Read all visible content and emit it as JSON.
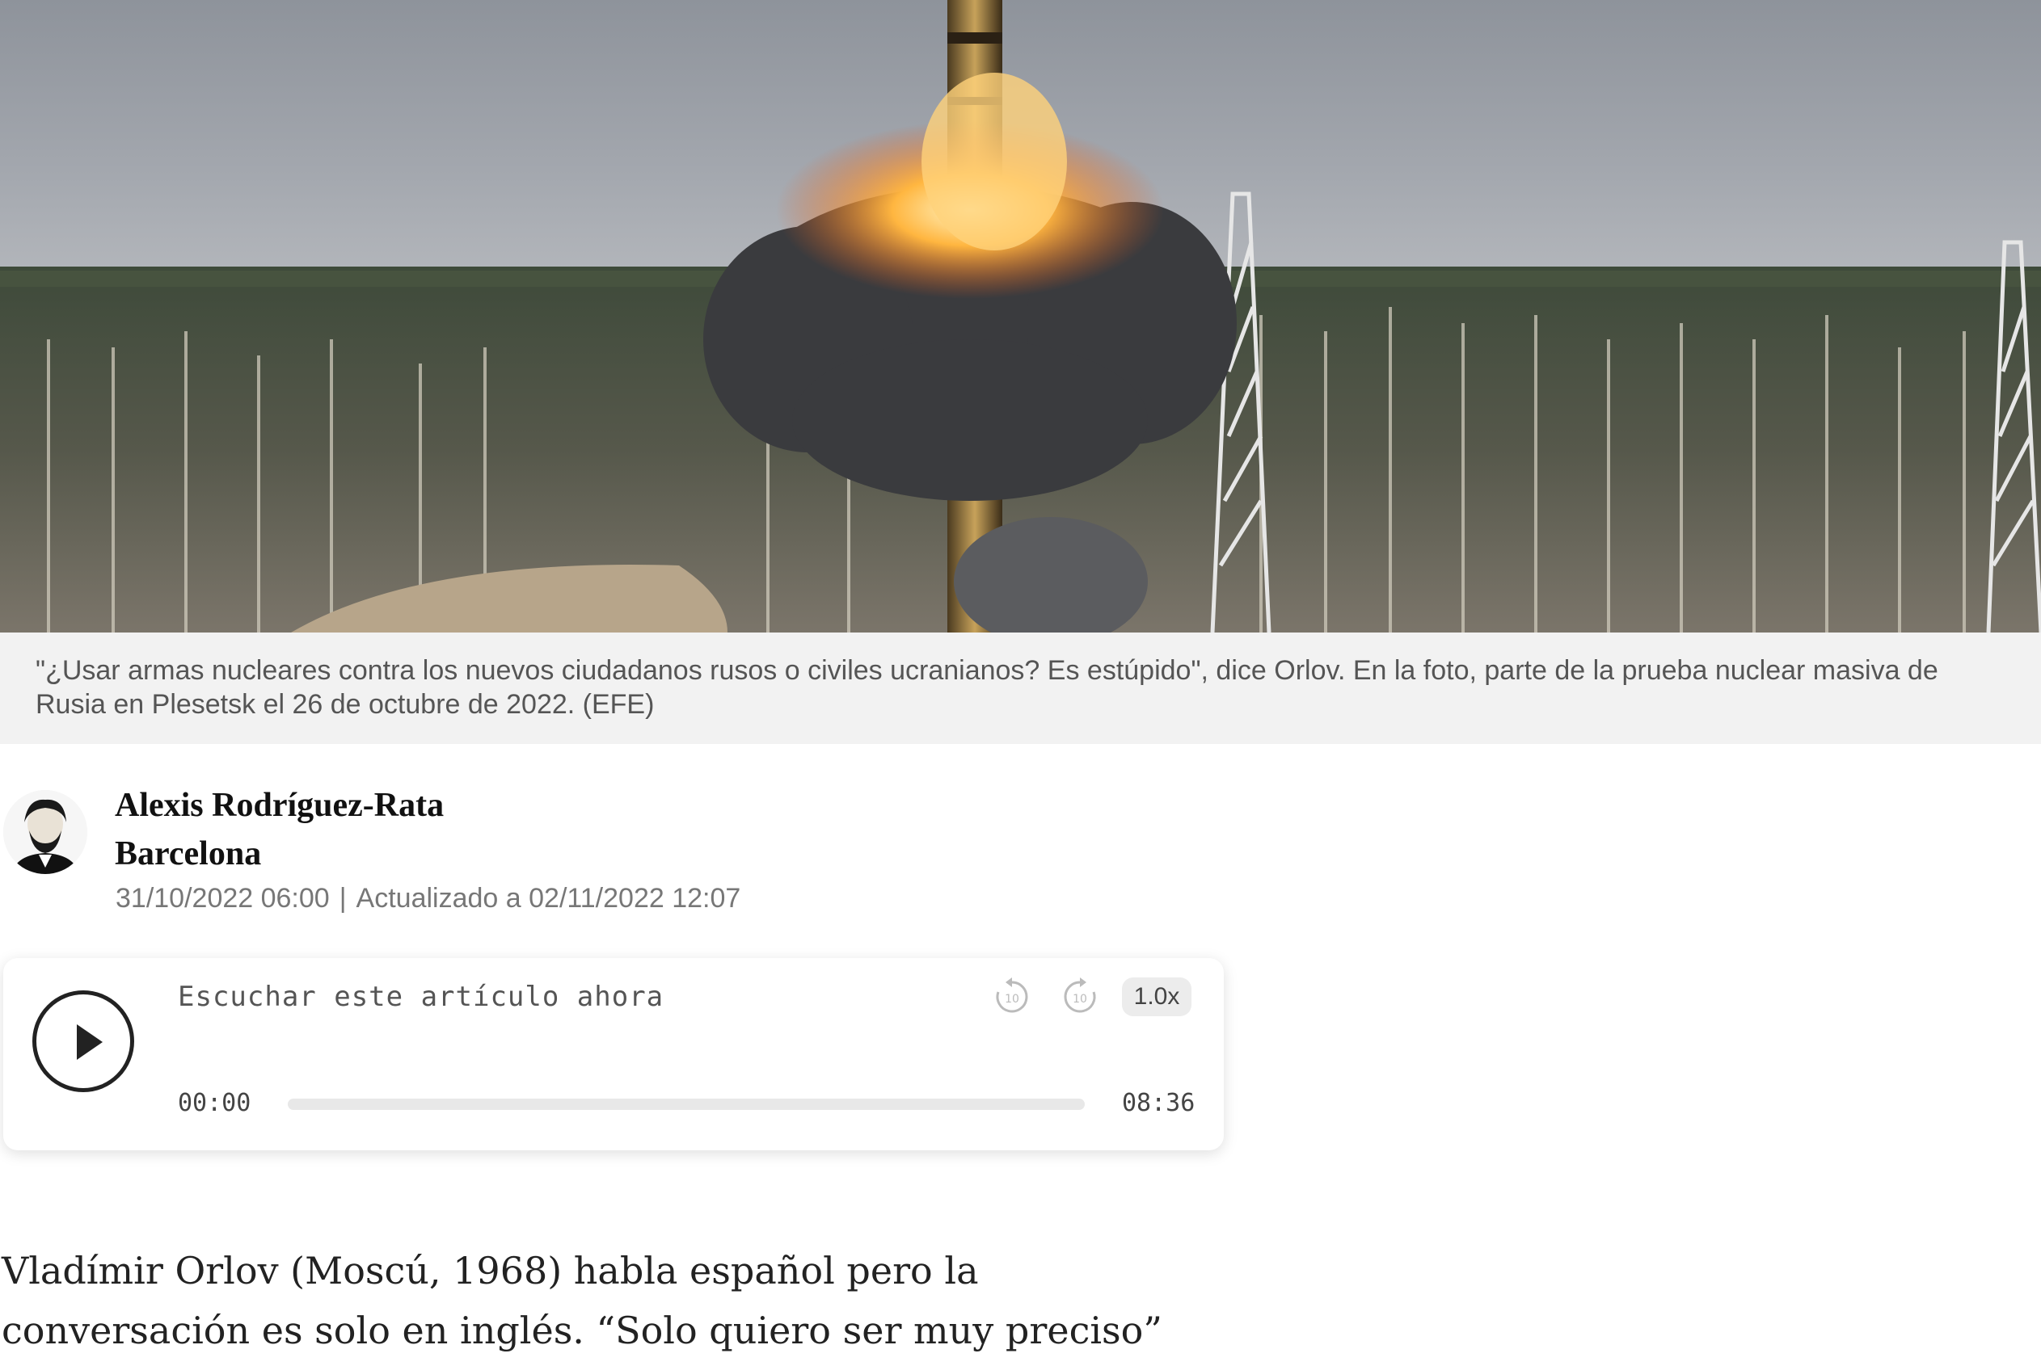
{
  "photo": {
    "description_icon": "missile-launch-photo"
  },
  "caption": {
    "text": "\"¿Usar armas nucleares contra los nuevos ciudadanos rusos o civiles ucranianos? Es estúpido\", dice Orlov. En la foto, parte de la prueba nuclear masiva de Rusia en Plesetsk el 26 de octubre de 2022.  (EFE)"
  },
  "author": {
    "name": "Alexis Rodríguez-Rata",
    "city": "Barcelona",
    "published": "31/10/2022 06:00",
    "separator": "|",
    "updated": "Actualizado a 02/11/2022 12:07"
  },
  "player": {
    "title": "Escuchar este artículo ahora",
    "rewind_label": "10",
    "forward_label": "10",
    "speed": "1.0x",
    "current_time": "00:00",
    "total_time": "08:36",
    "progress": 0,
    "icons": [
      "play-icon",
      "rewind-10-icon",
      "forward-10-icon"
    ]
  },
  "article": {
    "lead": "Vladímir Orlov (Moscú, 1968) habla español pero la conversación es solo en inglés. “Solo quiero ser muy preciso”"
  }
}
